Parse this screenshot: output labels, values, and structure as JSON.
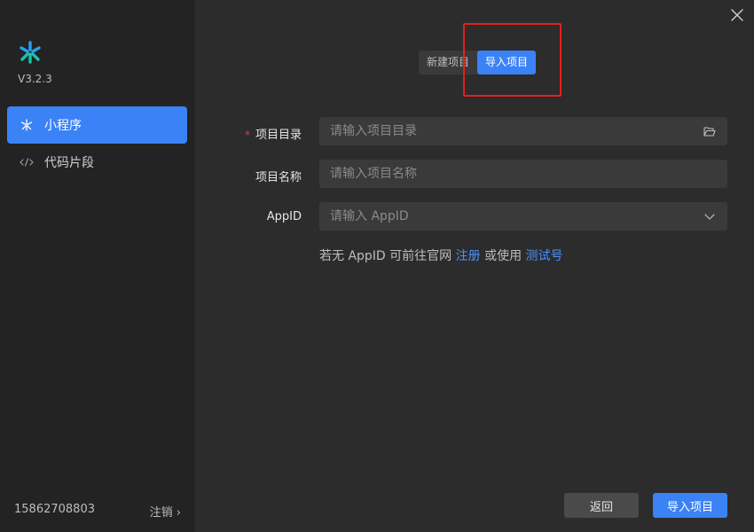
{
  "app": {
    "version": "V3.2.3",
    "accent": "#3b82f6",
    "logo_icon": "wechat-devtools-logo"
  },
  "sidebar": {
    "items": [
      {
        "label": "小程序",
        "icon": "miniprogram-icon",
        "active": true
      },
      {
        "label": "代码片段",
        "icon": "code-icon",
        "active": false
      }
    ],
    "account": "15862708803",
    "logout": "注销 ›"
  },
  "header": {
    "tabs": [
      {
        "label": "新建项目",
        "active": false
      },
      {
        "label": "导入项目",
        "active": true
      }
    ]
  },
  "form": {
    "project_dir": {
      "label": "项目目录",
      "required": true,
      "placeholder": "请输入项目目录",
      "value": ""
    },
    "project_name": {
      "label": "项目名称",
      "placeholder": "请输入项目名称",
      "value": ""
    },
    "appid": {
      "label": "AppID",
      "placeholder": "请输入 AppID",
      "value": ""
    },
    "hint_prefix": "若无 AppID 可前往官网 ",
    "hint_register": "注册",
    "hint_middle": " 或使用 ",
    "hint_test": "测试号"
  },
  "footer": {
    "back_label": "返回",
    "import_label": "导入项目"
  }
}
